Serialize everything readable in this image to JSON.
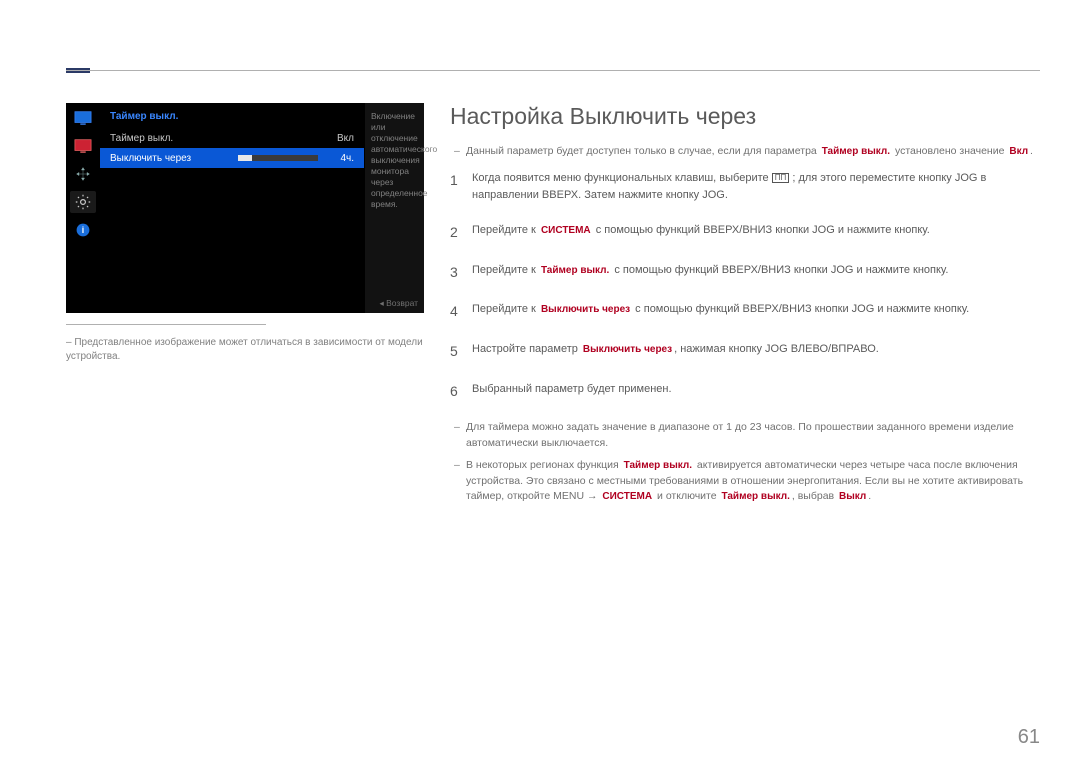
{
  "page_number": "61",
  "caption_prefix": "–",
  "caption": "Представленное изображение может отличаться в зависимости от модели устройства.",
  "osd": {
    "title": "Таймер выкл.",
    "rows": [
      {
        "label": "Таймер выкл.",
        "value": "Вкл"
      },
      {
        "label": "Выключить через",
        "value": "4ч."
      }
    ],
    "help": "Включение или отключение автоматического выключения монитора через определенное время.",
    "return": "Возврат"
  },
  "heading": "Настройка Выключить через",
  "intro_note_a": "Данный параметр будет доступен только в случае, если для параметра",
  "intro_note_b": "установлено значение",
  "tokens": {
    "off_timer": "Таймер выкл.",
    "on": "Вкл",
    "system": "СИСТЕМА",
    "turn_off_after": "Выключить через",
    "off": "Выкл"
  },
  "steps": [
    {
      "n": "1",
      "pre": "Когда появится меню функциональных клавиш, выберите ",
      "post": " ; для этого переместите кнопку JOG в направлении ВВЕРХ. Затем нажмите кнопку JOG."
    },
    {
      "n": "2",
      "pre": "Перейдите к ",
      "post": " с помощью функций ВВЕРХ/ВНИЗ кнопки JOG и нажмите кнопку."
    },
    {
      "n": "3",
      "pre": "Перейдите к ",
      "post": " с помощью функций ВВЕРХ/ВНИЗ кнопки JOG и нажмите кнопку."
    },
    {
      "n": "4",
      "pre": "Перейдите к ",
      "post": " с помощью функций ВВЕРХ/ВНИЗ кнопки JOG и нажмите кнопку."
    },
    {
      "n": "5",
      "pre": "Настройте параметр ",
      "post": ", нажимая кнопку JOG ВЛЕВО/ВПРАВО."
    },
    {
      "n": "6",
      "pre": "Выбранный параметр будет применен.",
      "post": ""
    }
  ],
  "footer1": "Для таймера можно задать значение в диапазоне от 1 до 23 часов. По прошествии заданного времени изделие автоматически выключается.",
  "footer2a": "В некоторых регионах функция",
  "footer2b": "активируется автоматически через четыре часа после включения устройства. Это связано с местными требованиями в отношении энергопитания. Если вы не хотите активировать таймер, откройте MENU →",
  "footer2c": "и отключите",
  "footer2d": ", выбрав"
}
